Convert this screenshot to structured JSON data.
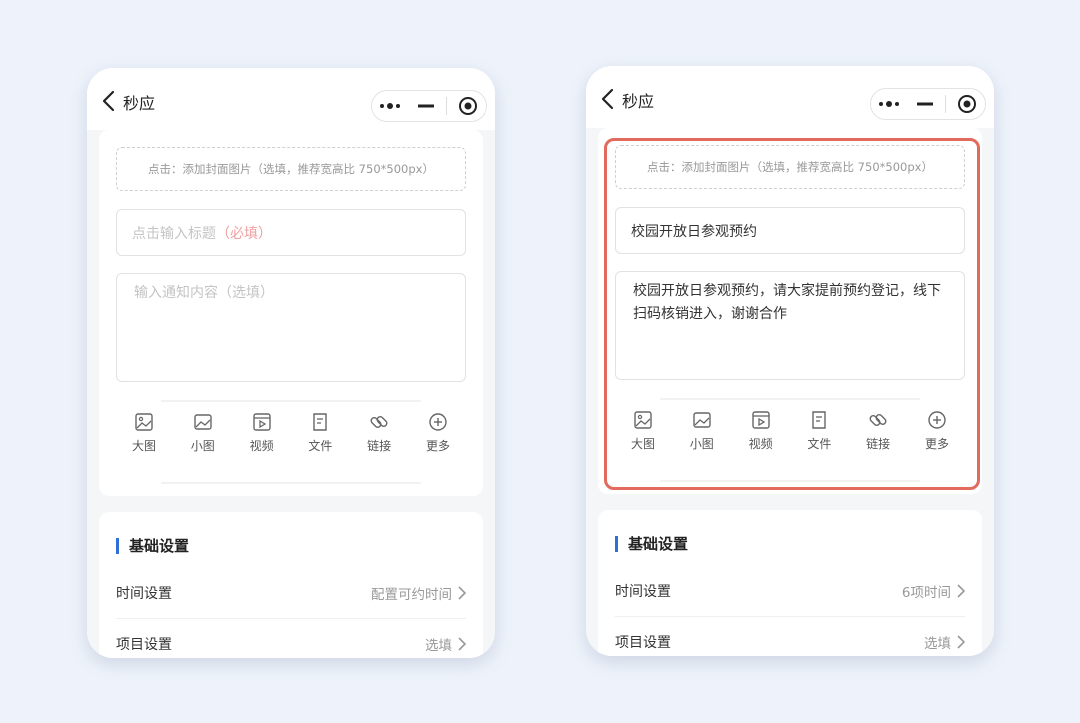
{
  "left": {
    "nav": {
      "title": "秒应"
    },
    "editor": {
      "cover_hint": "点击：添加封面图片（选填，推荐宽高比 750*500px）",
      "title_placeholder": "点击输入标题",
      "title_required": "（必填）",
      "content_placeholder": "输入通知内容（选填）"
    },
    "toolbar": [
      {
        "label": "大图",
        "icon": "large-image-icon"
      },
      {
        "label": "小图",
        "icon": "small-image-icon"
      },
      {
        "label": "视频",
        "icon": "video-icon"
      },
      {
        "label": "文件",
        "icon": "file-icon"
      },
      {
        "label": "链接",
        "icon": "link-icon"
      },
      {
        "label": "更多",
        "icon": "plus-circle-icon"
      }
    ],
    "settings": {
      "section_title": "基础设置",
      "rows": [
        {
          "label": "时间设置",
          "value": "配置可约时间"
        },
        {
          "label": "项目设置",
          "value": "选填"
        }
      ]
    }
  },
  "right": {
    "nav": {
      "title": "秒应"
    },
    "editor": {
      "cover_hint": "点击：添加封面图片（选填，推荐宽高比 750*500px）",
      "title_value": "校园开放日参观预约",
      "content_value": "校园开放日参观预约，请大家提前预约登记，线下扫码核销进入，谢谢合作"
    },
    "toolbar": [
      {
        "label": "大图",
        "icon": "large-image-icon"
      },
      {
        "label": "小图",
        "icon": "small-image-icon"
      },
      {
        "label": "视频",
        "icon": "video-icon"
      },
      {
        "label": "文件",
        "icon": "file-icon"
      },
      {
        "label": "链接",
        "icon": "link-icon"
      },
      {
        "label": "更多",
        "icon": "plus-circle-icon"
      }
    ],
    "settings": {
      "section_title": "基础设置",
      "rows": [
        {
          "label": "时间设置",
          "value": "6项时间"
        },
        {
          "label": "项目设置",
          "value": "选填"
        }
      ]
    }
  },
  "colors": {
    "accent": "#2f6fd6",
    "highlight": "#e36b5d",
    "background": "#eef3fb"
  }
}
